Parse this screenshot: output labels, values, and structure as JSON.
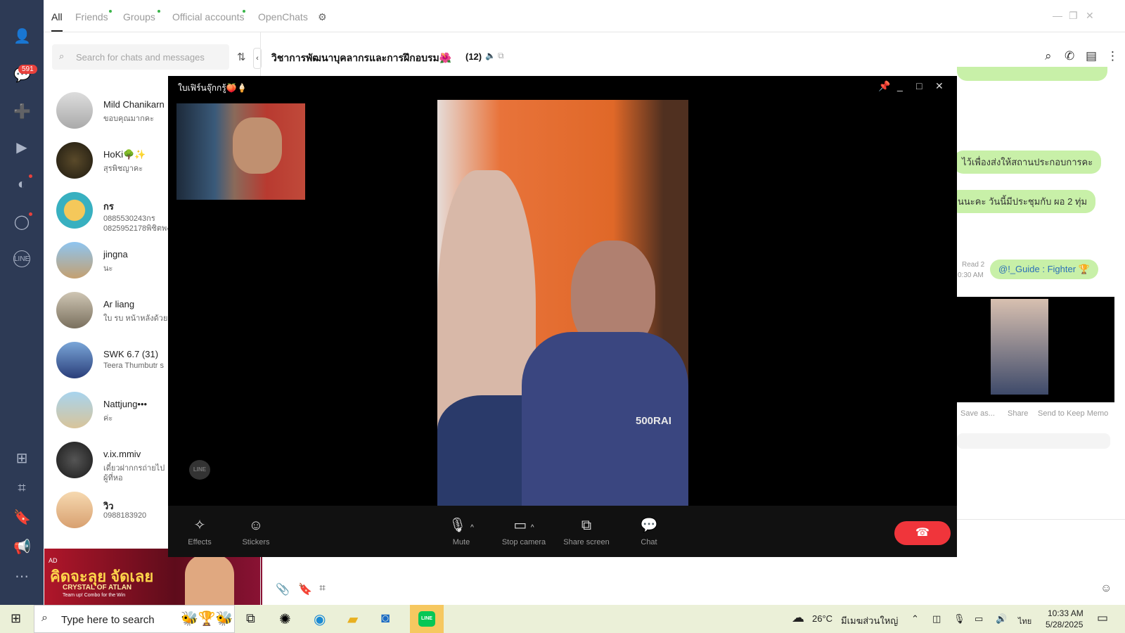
{
  "tabs": {
    "items": [
      {
        "label": "All",
        "active": true
      },
      {
        "label": "Friends",
        "dot": true
      },
      {
        "label": "Groups",
        "dot": true
      },
      {
        "label": "Official accounts",
        "dot": true
      },
      {
        "label": "OpenChats"
      }
    ]
  },
  "rail": {
    "badge": "591"
  },
  "search": {
    "placeholder": "Search for chats and messages"
  },
  "chats": [
    {
      "name": "Mild Chanikarn",
      "preview": "ขอบคุณมากคะ"
    },
    {
      "name": "HoKi🌳✨",
      "preview": "สุรพิชญาคะ"
    },
    {
      "name": "กร",
      "preview": "0885530243กร",
      "preview2": "0825952178พิชิตพงษ์"
    },
    {
      "name": "jingna",
      "preview": "นะ"
    },
    {
      "name": "Ar liang",
      "preview": "ใบ รบ หน้าหลังด้วย"
    },
    {
      "name": "SWK 6.7 (31)",
      "preview": "Teera Thumbutr s"
    },
    {
      "name": "Nattjung•••",
      "preview": "ค่ะ"
    },
    {
      "name": "v.ix.mmiv",
      "preview": "เดี๋ยวฝากกรถ่ายไป",
      "preview2": "ผู้ที่หอ"
    },
    {
      "name": "วิว",
      "preview": "0988183920"
    }
  ],
  "chat_header": {
    "title": "วิชาการพัฒนาบุคลากรและการฝึกอบรม🌺",
    "count": "(12)"
  },
  "bubbles": [
    {
      "text": "ไว้เพื่องส่งให้สถานประกอบการคะ"
    },
    {
      "text": "นนะคะ วันนี้มีประชุมกับ  ผอ 2 ทุ่ม"
    },
    {
      "text": "@!_Guide : Fighter 🏆"
    }
  ],
  "read_status": {
    "line1": "Read 2",
    "line2": "0:30 AM"
  },
  "media_actions": [
    "Save as...",
    "Share",
    "Send to Keep Memo"
  ],
  "call": {
    "title": "ใบเฟิร์นจุ๊กกรู้🍑🍦",
    "toolbar": {
      "effects": "Effects",
      "stickers": "Stickers",
      "mute": "Mute",
      "stop_camera": "Stop camera",
      "share_screen": "Share screen",
      "chat": "Chat"
    },
    "logo": "LINE",
    "shirt_text": "500RAI"
  },
  "ad": {
    "label": "AD",
    "headline": "คิดจะลุย จัดเลย",
    "sub": "CRYSTAL OF ATLAN",
    "tag": "Team up! Combo for the Win"
  },
  "taskbar": {
    "search": "Type here to search",
    "weather": "26°C",
    "location": "มีเมฆส่วนใหญ่",
    "lang": "ไทย",
    "time": "10:33 AM",
    "date": "5/28/2025"
  },
  "colors": {
    "rail": "#2d3a55",
    "bubble": "#c8f0a8",
    "endcall": "#f0353b",
    "accent_green": "#06c755"
  }
}
